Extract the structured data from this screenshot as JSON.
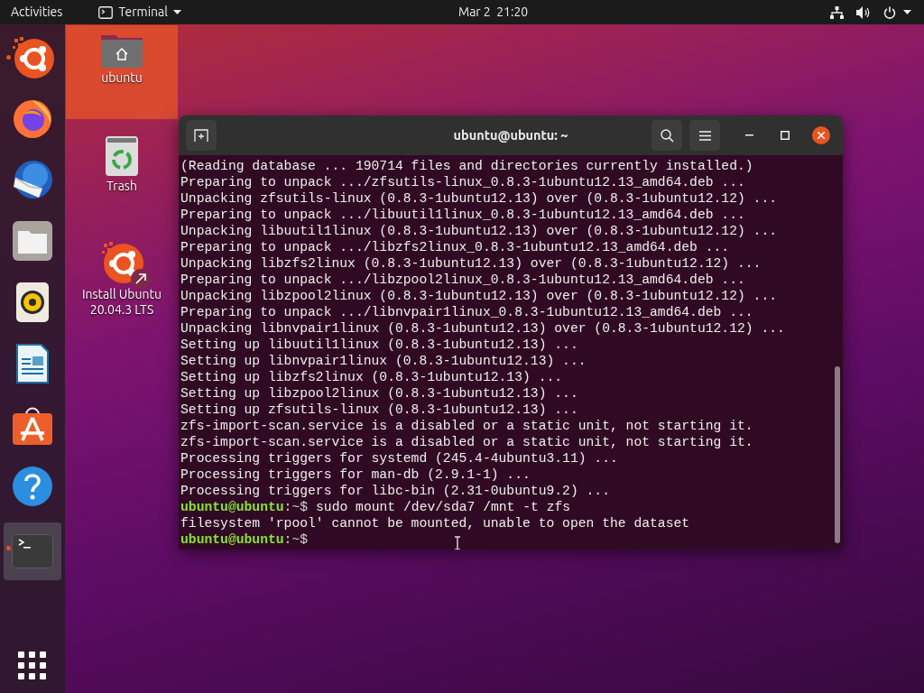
{
  "top_bar": {
    "activities": "Activities",
    "app_menu": "Terminal",
    "clock": "Mar 2  21:20"
  },
  "dock": [
    {
      "kind": "installer",
      "running": true,
      "selected": false
    },
    {
      "kind": "firefox",
      "running": false,
      "selected": false
    },
    {
      "kind": "thunderbird",
      "running": false,
      "selected": false
    },
    {
      "kind": "files",
      "running": false,
      "selected": false
    },
    {
      "kind": "rhythmbox",
      "running": false,
      "selected": false
    },
    {
      "kind": "writer",
      "running": false,
      "selected": false
    },
    {
      "kind": "software",
      "running": false,
      "selected": false
    },
    {
      "kind": "help",
      "running": false,
      "selected": false
    },
    {
      "kind": "terminal",
      "running": true,
      "selected": true
    }
  ],
  "desktop_icons": [
    {
      "kind": "home",
      "label": "ubuntu",
      "selected": true
    },
    {
      "kind": "trash",
      "label": "Trash",
      "selected": false
    },
    {
      "kind": "installer",
      "label": "Install Ubuntu 20.04.3 LTS",
      "selected": false
    }
  ],
  "terminal": {
    "title": "ubuntu@ubuntu: ~",
    "lines": [
      {
        "kind": "output",
        "text": "(Reading database ... 190714 files and directories currently installed.)"
      },
      {
        "kind": "output",
        "text": "Preparing to unpack .../zfsutils-linux_0.8.3-1ubuntu12.13_amd64.deb ..."
      },
      {
        "kind": "output",
        "text": "Unpacking zfsutils-linux (0.8.3-1ubuntu12.13) over (0.8.3-1ubuntu12.12) ..."
      },
      {
        "kind": "output",
        "text": "Preparing to unpack .../libuutil1linux_0.8.3-1ubuntu12.13_amd64.deb ..."
      },
      {
        "kind": "output",
        "text": "Unpacking libuutil1linux (0.8.3-1ubuntu12.13) over (0.8.3-1ubuntu12.12) ..."
      },
      {
        "kind": "output",
        "text": "Preparing to unpack .../libzfs2linux_0.8.3-1ubuntu12.13_amd64.deb ..."
      },
      {
        "kind": "output",
        "text": "Unpacking libzfs2linux (0.8.3-1ubuntu12.13) over (0.8.3-1ubuntu12.12) ..."
      },
      {
        "kind": "output",
        "text": "Preparing to unpack .../libzpool2linux_0.8.3-1ubuntu12.13_amd64.deb ..."
      },
      {
        "kind": "output",
        "text": "Unpacking libzpool2linux (0.8.3-1ubuntu12.13) over (0.8.3-1ubuntu12.12) ..."
      },
      {
        "kind": "output",
        "text": "Preparing to unpack .../libnvpair1linux_0.8.3-1ubuntu12.13_amd64.deb ..."
      },
      {
        "kind": "output",
        "text": "Unpacking libnvpair1linux (0.8.3-1ubuntu12.13) over (0.8.3-1ubuntu12.12) ..."
      },
      {
        "kind": "output",
        "text": "Setting up libuutil1linux (0.8.3-1ubuntu12.13) ..."
      },
      {
        "kind": "output",
        "text": "Setting up libnvpair1linux (0.8.3-1ubuntu12.13) ..."
      },
      {
        "kind": "output",
        "text": "Setting up libzfs2linux (0.8.3-1ubuntu12.13) ..."
      },
      {
        "kind": "output",
        "text": "Setting up libzpool2linux (0.8.3-1ubuntu12.13) ..."
      },
      {
        "kind": "output",
        "text": "Setting up zfsutils-linux (0.8.3-1ubuntu12.13) ..."
      },
      {
        "kind": "output",
        "text": "zfs-import-scan.service is a disabled or a static unit, not starting it."
      },
      {
        "kind": "output",
        "text": "zfs-import-scan.service is a disabled or a static unit, not starting it."
      },
      {
        "kind": "output",
        "text": "Processing triggers for systemd (245.4-4ubuntu3.11) ..."
      },
      {
        "kind": "output",
        "text": "Processing triggers for man-db (2.9.1-1) ..."
      },
      {
        "kind": "output",
        "text": "Processing triggers for libc-bin (2.31-0ubuntu9.2) ..."
      },
      {
        "kind": "prompt",
        "user": "ubuntu@ubuntu",
        "suffix": ":~$",
        "command": "sudo mount /dev/sda7 /mnt -t zfs"
      },
      {
        "kind": "output",
        "text": "filesystem 'rpool' cannot be mounted, unable to open the dataset"
      },
      {
        "kind": "prompt",
        "user": "ubuntu@ubuntu",
        "suffix": ":~$"
      }
    ]
  }
}
